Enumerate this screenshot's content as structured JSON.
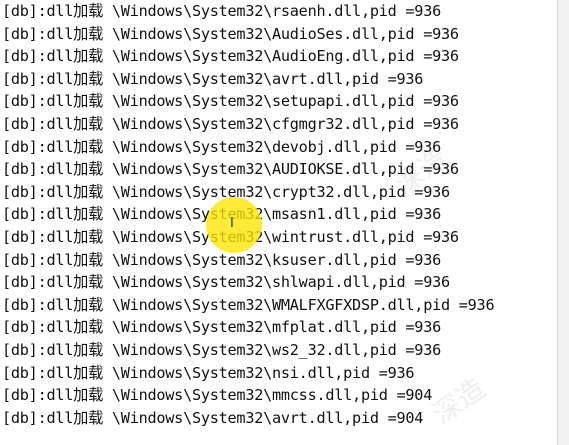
{
  "log": {
    "lines": [
      "[db]:dll加载 \\Windows\\System32\\rsaenh.dll,pid =936",
      "[db]:dll加载 \\Windows\\System32\\AudioSes.dll,pid =936",
      "[db]:dll加载 \\Windows\\System32\\AudioEng.dll,pid =936",
      "[db]:dll加载 \\Windows\\System32\\avrt.dll,pid =936",
      "[db]:dll加载 \\Windows\\System32\\setupapi.dll,pid =936",
      "[db]:dll加载 \\Windows\\System32\\cfgmgr32.dll,pid =936",
      "[db]:dll加载 \\Windows\\System32\\devobj.dll,pid =936",
      "[db]:dll加载 \\Windows\\System32\\AUDIOKSE.dll,pid =936",
      "[db]:dll加载 \\Windows\\System32\\crypt32.dll,pid =936",
      "[db]:dll加载 \\Windows\\System32\\msasn1.dll,pid =936",
      "[db]:dll加载 \\Windows\\System32\\wintrust.dll,pid =936",
      "[db]:dll加载 \\Windows\\System32\\ksuser.dll,pid =936",
      "[db]:dll加载 \\Windows\\System32\\shlwapi.dll,pid =936",
      "[db]:dll加载 \\Windows\\System32\\WMALFXGFXDSP.dll,pid =936",
      "[db]:dll加载 \\Windows\\System32\\mfplat.dll,pid =936",
      "[db]:dll加载 \\Windows\\System32\\ws2_32.dll,pid =936",
      "[db]:dll加载 \\Windows\\System32\\nsi.dll,pid =936",
      "[db]:dll加载 \\Windows\\System32\\mmcss.dll,pid =904",
      "[db]:dll加载 \\Windows\\System32\\avrt.dll,pid =904"
    ]
  },
  "watermark": {
    "text": "深造"
  },
  "colors": {
    "text": "#111111",
    "background": "#ffffff",
    "cursor_highlight": "#ffe600"
  },
  "icons": {
    "cursor": "text-cursor-icon"
  }
}
